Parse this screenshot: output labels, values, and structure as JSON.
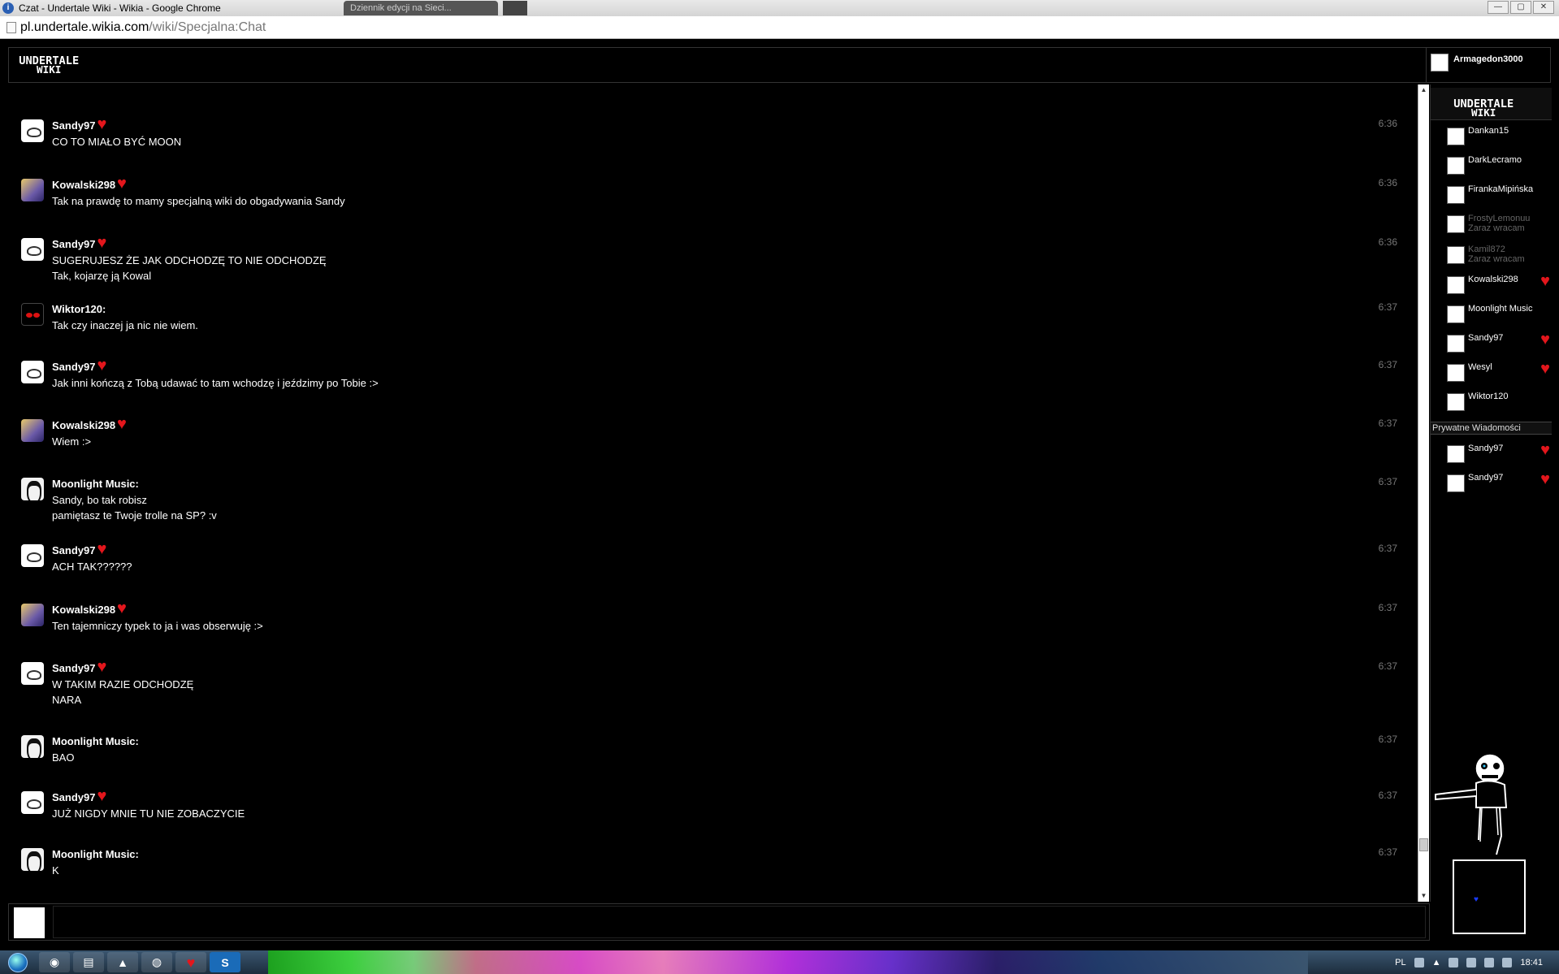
{
  "browser": {
    "window_title": "Czat - Undertale Wiki - Wikia - Google Chrome",
    "second_tab": "Dziennik edycji na Sieci...",
    "url_host": "pl.undertale.wikia.com",
    "url_path": "/wiki/Specjalna:Chat",
    "win_buttons": [
      "—",
      "▢",
      "✕"
    ]
  },
  "header": {
    "logo_line1": "UNDERTALE",
    "logo_line2": "WIKI",
    "current_user": "Armagedon3000"
  },
  "messages": [
    {
      "user": "Sandy97",
      "heart": true,
      "avatar": "sandy",
      "lines": [
        "CO TO MIAŁO BYĆ MOON"
      ],
      "time": "6:36"
    },
    {
      "user": "Kowalski298",
      "heart": true,
      "avatar": "kowal",
      "lines": [
        "Tak na prawdę to mamy specjalną wiki do obgadywania Sandy"
      ],
      "time": "6:36"
    },
    {
      "user": "Sandy97",
      "heart": true,
      "avatar": "sandy",
      "lines": [
        "SUGERUJESZ ŻE JAK ODCHODZĘ TO NIE ODCHODZĘ",
        "Tak, kojarzę ją Kowal"
      ],
      "time": "6:36"
    },
    {
      "user": "Wiktor120:",
      "heart": false,
      "avatar": "wiktor",
      "lines": [
        "Tak czy inaczej ja nic nie wiem."
      ],
      "time": "6:37"
    },
    {
      "user": "Sandy97",
      "heart": true,
      "avatar": "sandy",
      "lines": [
        "Jak inni kończą z Tobą udawać to tam wchodzę i jeździmy po Tobie :>"
      ],
      "time": "6:37"
    },
    {
      "user": "Kowalski298",
      "heart": true,
      "avatar": "kowal",
      "lines": [
        "Wiem :>"
      ],
      "time": "6:37"
    },
    {
      "user": "Moonlight Music:",
      "heart": false,
      "avatar": "moon",
      "lines": [
        "Sandy, bo tak robisz",
        "pamiętasz te Twoje trolle na SP? :v"
      ],
      "time": "6:37"
    },
    {
      "user": "Sandy97",
      "heart": true,
      "avatar": "sandy",
      "lines": [
        "ACH TAK??????"
      ],
      "time": "6:37"
    },
    {
      "user": "Kowalski298",
      "heart": true,
      "avatar": "kowal",
      "lines": [
        "Ten tajemniczy typek to ja i was obserwuję :>"
      ],
      "time": "6:37"
    },
    {
      "user": "Sandy97",
      "heart": true,
      "avatar": "sandy",
      "lines": [
        "W TAKIM RAZIE ODCHODZĘ",
        "NARA"
      ],
      "time": "6:37"
    },
    {
      "user": "Moonlight Music:",
      "heart": false,
      "avatar": "moon",
      "lines": [
        "BAO"
      ],
      "time": "6:37"
    },
    {
      "user": "Sandy97",
      "heart": true,
      "avatar": "sandy",
      "lines": [
        "JUŻ NIGDY MNIE TU NIE ZOBACZYCIE"
      ],
      "time": "6:37"
    },
    {
      "user": "Moonlight Music:",
      "heart": false,
      "avatar": "moon",
      "lines": [
        "K"
      ],
      "time": "6:37"
    }
  ],
  "userlist": {
    "users": [
      {
        "name": "Dankan15",
        "status": "",
        "heart": false,
        "away": false
      },
      {
        "name": "DarkLecramo",
        "status": "",
        "heart": false,
        "away": false
      },
      {
        "name": "FirankaMipińska",
        "status": "",
        "heart": false,
        "away": false
      },
      {
        "name": "FrostyLemonuu",
        "status": "Zaraz wracam",
        "heart": false,
        "away": true
      },
      {
        "name": "Kamil872",
        "status": "Zaraz wracam",
        "heart": false,
        "away": true
      },
      {
        "name": "Kowalski298",
        "status": "",
        "heart": true,
        "away": false
      },
      {
        "name": "Moonlight Music",
        "status": "",
        "heart": false,
        "away": false
      },
      {
        "name": "Sandy97",
        "status": "",
        "heart": true,
        "away": false
      },
      {
        "name": "Wesyl",
        "status": "",
        "heart": true,
        "away": false
      },
      {
        "name": "Wiktor120",
        "status": "",
        "heart": false,
        "away": false
      }
    ],
    "private_header": "Prywatne Wiadomości",
    "private": [
      {
        "name": "Sandy97",
        "heart": true
      },
      {
        "name": "Sandy97",
        "heart": true
      }
    ]
  },
  "taskbar": {
    "lang": "PL",
    "clock": "18:41"
  },
  "colors": {
    "heart": "#e3161c",
    "background": "#000000",
    "timestamp": "#777777"
  }
}
